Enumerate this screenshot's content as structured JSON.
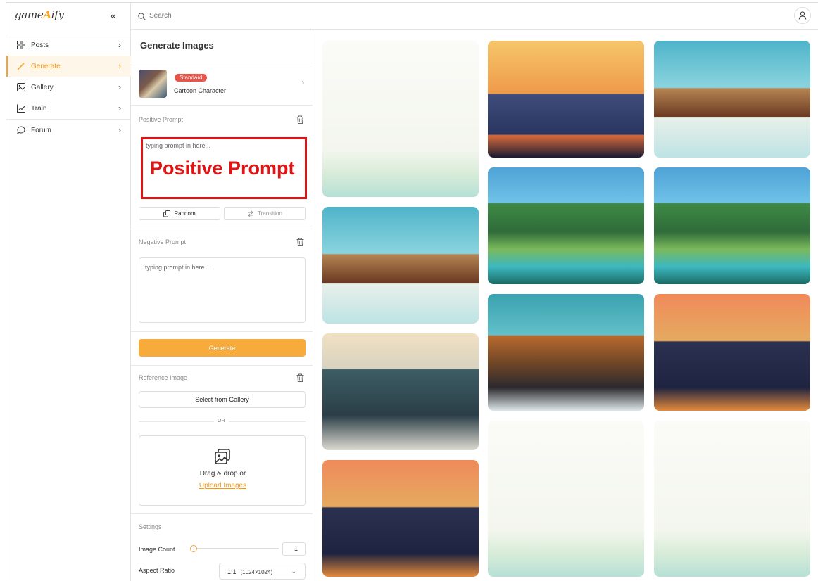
{
  "app": {
    "logo_text": "gameAify",
    "logo_accent_color": "#f6a623"
  },
  "sidebar": {
    "items": [
      {
        "label": "Posts",
        "icon": "grid-icon"
      },
      {
        "label": "Generate",
        "icon": "magic-wand-icon",
        "active": true
      },
      {
        "label": "Gallery",
        "icon": "image-icon"
      },
      {
        "label": "Train",
        "icon": "chart-icon"
      },
      {
        "label": "Forum",
        "icon": "chat-bubble-icon"
      }
    ]
  },
  "topbar": {
    "search_placeholder": "Search"
  },
  "panel": {
    "title": "Generate Images",
    "model": {
      "badge": "Standard",
      "name": "Cartoon Character"
    },
    "positive": {
      "label": "Positive Prompt",
      "placeholder": "typing prompt in here...",
      "annotation": "Positive Prompt"
    },
    "random_label": "Random",
    "transition_label": "Transition",
    "negative": {
      "label": "Negative Prompt",
      "placeholder": "typing prompt in here..."
    },
    "generate_label": "Generate",
    "reference": {
      "label": "Reference Image",
      "select_label": "Select from Gallery",
      "or": "OR",
      "drop_text": "Drag & drop or",
      "upload_text": "Upload Images"
    },
    "settings": {
      "label": "Settings",
      "image_count_label": "Image Count",
      "image_count": "1",
      "aspect_label": "Aspect Ratio",
      "aspect_value": "1:1",
      "aspect_detail": "(1024×1024)"
    }
  },
  "colors": {
    "accent": "#f6ab3a",
    "active_nav_bg": "#fff6ea",
    "annotation_red": "#e01414",
    "badge_red": "#e8554a"
  }
}
